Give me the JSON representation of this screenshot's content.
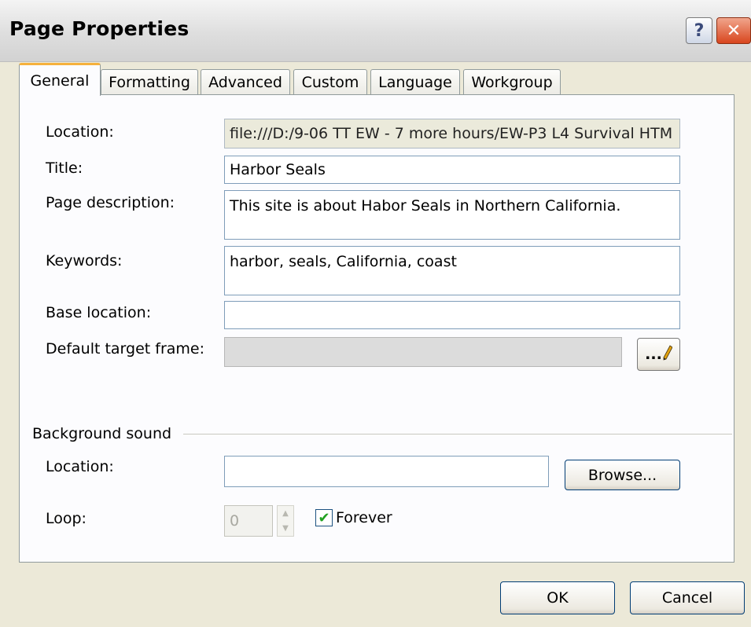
{
  "window": {
    "title": "Page Properties",
    "help_glyph": "?",
    "close_glyph": "✕"
  },
  "tabs": [
    {
      "label": "General",
      "active": true
    },
    {
      "label": "Formatting",
      "active": false
    },
    {
      "label": "Advanced",
      "active": false
    },
    {
      "label": "Custom",
      "active": false
    },
    {
      "label": "Language",
      "active": false
    },
    {
      "label": "Workgroup",
      "active": false
    }
  ],
  "general": {
    "location_label": "Location:",
    "location_value": "file:///D:/9-06 TT EW - 7 more hours/EW-P3 L4 Survival HTM",
    "title_label": "Title:",
    "title_value": "Harbor Seals",
    "description_label": "Page description:",
    "description_value": "This site is about Habor Seals in Northern California.",
    "keywords_label": "Keywords:",
    "keywords_value": "harbor, seals, California, coast",
    "base_location_label": "Base location:",
    "base_location_value": "",
    "target_frame_label": "Default target frame:",
    "target_frame_value": "",
    "target_frame_button": "...",
    "pencil_icon": "pencil-icon"
  },
  "background_sound": {
    "group_label": "Background sound",
    "location_label": "Location:",
    "location_value": "",
    "browse_button": "Browse...",
    "loop_label": "Loop:",
    "loop_value": "0",
    "forever_label": "Forever",
    "forever_checked": true
  },
  "footer": {
    "ok_button": "OK",
    "cancel_button": "Cancel"
  },
  "colors": {
    "dialog_bg": "#ece9d8",
    "panel_bg": "#fcfcfe",
    "active_tab_accent": "#f5b13c",
    "close_button": "#d8451e",
    "field_border": "#7f9db9",
    "checkmark": "#21a121"
  }
}
